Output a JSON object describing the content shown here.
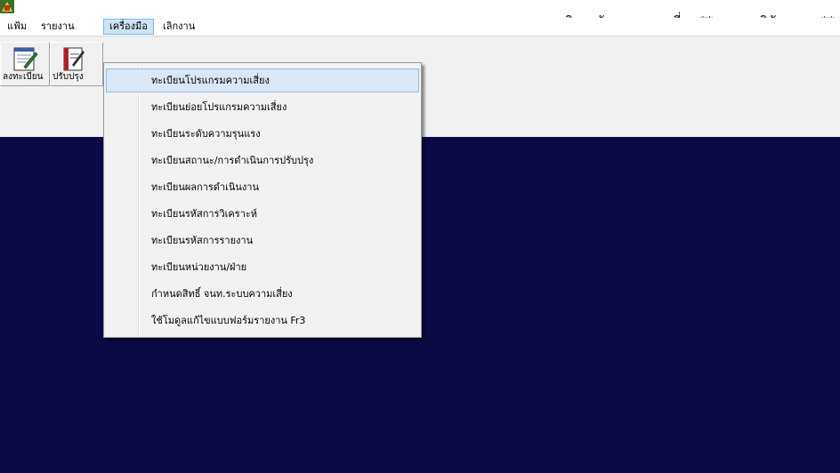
{
  "window": {
    "title": "ระบบบริหารจัดการความเสี่ยง   ** อุทุมพรพิสัย,รพช. **",
    "icon": "app-icon"
  },
  "menubar": {
    "items": [
      {
        "label": "แฟ้ม"
      },
      {
        "label": "รายงาน"
      },
      {
        "label": "เครื่องมือ"
      },
      {
        "label": "เลิกงาน"
      }
    ],
    "active_index": 2
  },
  "toolbar": {
    "buttons": [
      {
        "label": "ลงทะเบียน",
        "icon": "register-notepad-icon"
      },
      {
        "label": "ปรับปรุง",
        "icon": "edit-document-icon"
      }
    ]
  },
  "tools_menu": {
    "items": [
      {
        "label": "ทะเบียนโปรแกรมความเสี่ยง"
      },
      {
        "label": "ทะเบียนย่อยโปรแกรมความเสี่ยง"
      },
      {
        "label": "ทะเบียนระดับความรุนแรง"
      },
      {
        "label": "ทะเบียนสถานะ/การดำเนินการปรับปรุง"
      },
      {
        "label": "ทะเบียนผลการดำเนินงาน"
      },
      {
        "label": "ทะเบียนรหัสการวิเคราะห์"
      },
      {
        "label": "ทะเบียนรหัสการรายงาน"
      },
      {
        "label": "ทะเบียนหน่วยงาน/ฝ่าย"
      },
      {
        "label": "กำหนดสิทธิ์ จนท.ระบบความเสี่ยง"
      },
      {
        "label": "ใช้โมดูลแก้ไขแบบฟอร์มรายงาน Fr3"
      }
    ],
    "highlighted_index": 0
  },
  "colors": {
    "workspace_background": "#0b0a44",
    "menu_highlight": "#d9e7f7"
  }
}
